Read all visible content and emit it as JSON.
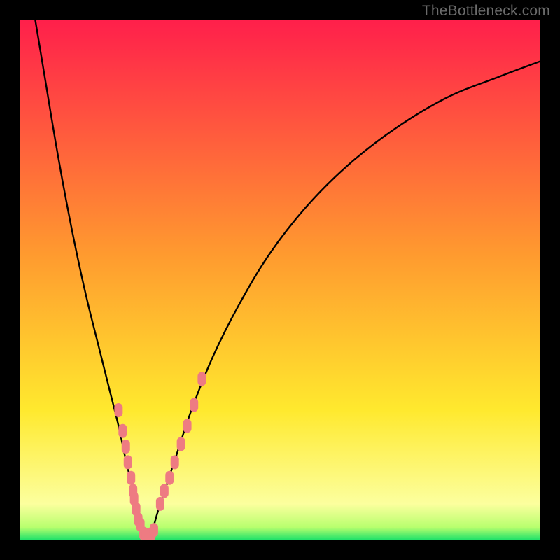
{
  "watermark": "TheBottleneck.com",
  "chart_data": {
    "type": "line",
    "title": "",
    "xlabel": "",
    "ylabel": "",
    "xlim": [
      0,
      100
    ],
    "ylim": [
      0,
      100
    ],
    "legend": false,
    "grid": false,
    "background_gradient": {
      "stops": [
        {
          "pos": 0.0,
          "color": "#ff1f4b"
        },
        {
          "pos": 0.45,
          "color": "#ff9a2f"
        },
        {
          "pos": 0.75,
          "color": "#ffe92e"
        },
        {
          "pos": 0.93,
          "color": "#fcff9e"
        },
        {
          "pos": 0.975,
          "color": "#b7ff6e"
        },
        {
          "pos": 1.0,
          "color": "#18e06a"
        }
      ]
    },
    "series": [
      {
        "name": "bottleneck-curve",
        "type": "line",
        "color": "#000000",
        "x": [
          3,
          5,
          7,
          9,
          11,
          13,
          15,
          17,
          19,
          20.5,
          22,
          23.3,
          24.5,
          25.5,
          26.7,
          30,
          33,
          37,
          42,
          48,
          55,
          63,
          72,
          82,
          92,
          100
        ],
        "y": [
          100,
          88,
          76,
          65,
          55,
          46,
          38,
          30,
          22,
          15,
          9,
          4,
          1,
          2,
          6,
          16,
          25,
          35,
          45,
          55,
          64,
          72,
          79,
          85,
          89,
          92
        ]
      },
      {
        "name": "sample-points-left",
        "type": "scatter",
        "color": "#ee7b82",
        "x": [
          19.0,
          19.8,
          20.4,
          20.8,
          21.4,
          21.8,
          22.0,
          22.4,
          22.8,
          23.2
        ],
        "y": [
          25.0,
          21.0,
          18.0,
          15.0,
          12.0,
          9.5,
          8.0,
          6.0,
          4.0,
          3.0
        ]
      },
      {
        "name": "sample-points-bottom",
        "type": "scatter",
        "color": "#ee7b82",
        "x": [
          23.8,
          24.3,
          24.8,
          25.3,
          25.8
        ],
        "y": [
          1.3,
          1.0,
          1.0,
          1.2,
          2.0
        ]
      },
      {
        "name": "sample-points-right",
        "type": "scatter",
        "color": "#ee7b82",
        "x": [
          27.0,
          27.8,
          28.8,
          29.8,
          31.0,
          32.2,
          33.5,
          35.0
        ],
        "y": [
          7.0,
          9.5,
          12.0,
          15.0,
          18.5,
          22.0,
          26.0,
          31.0
        ]
      }
    ]
  }
}
